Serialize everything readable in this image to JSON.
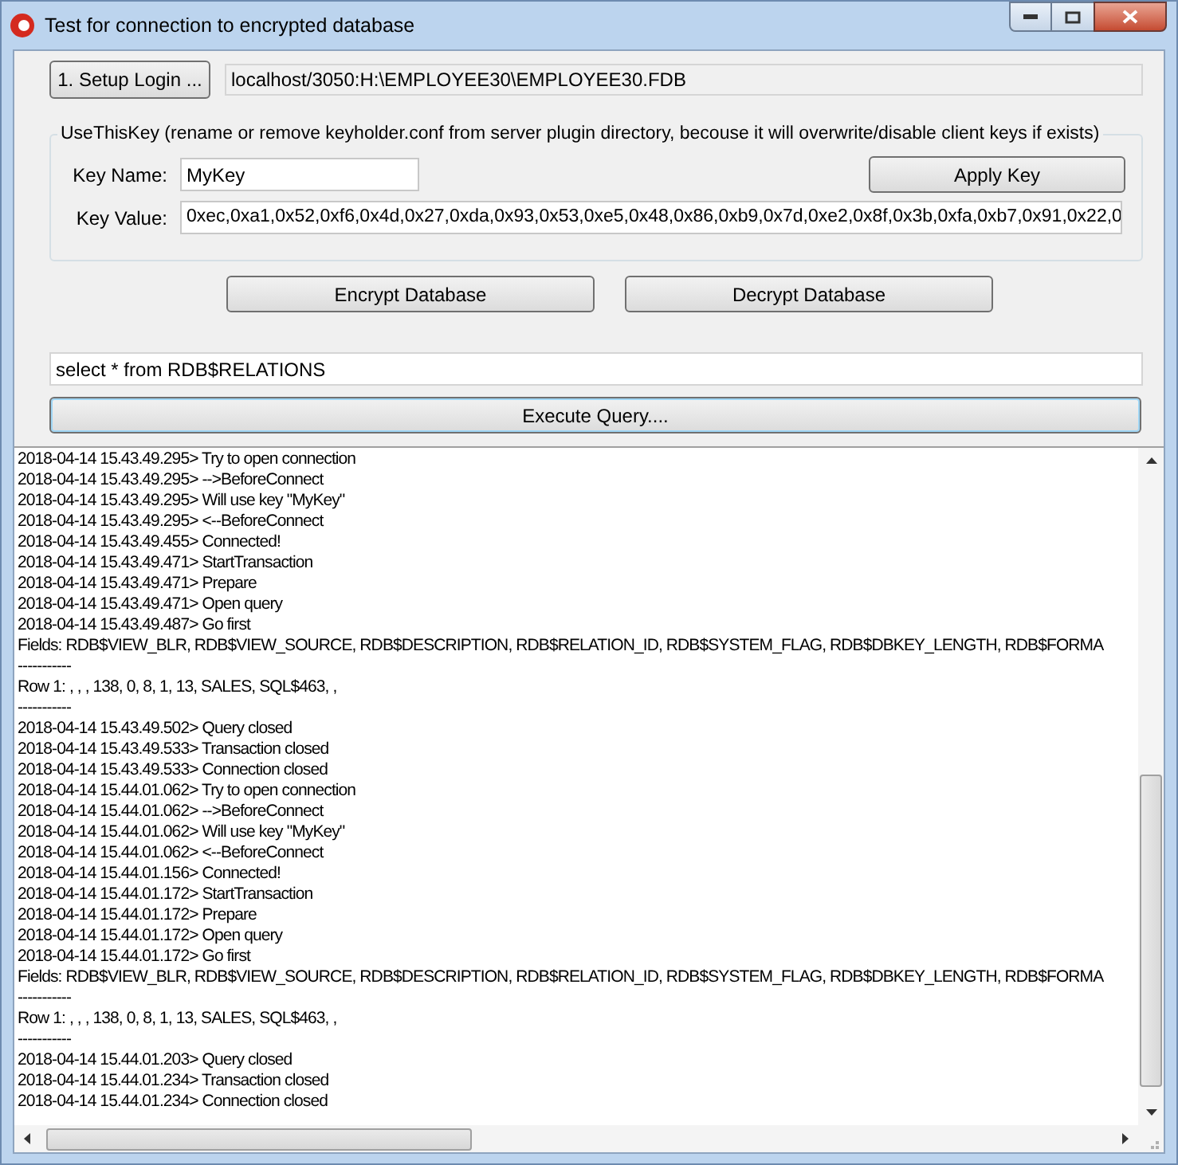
{
  "window": {
    "title": "Test for connection to encrypted database"
  },
  "setup_button": {
    "label": "1. Setup Login ..."
  },
  "database_path": {
    "value": "localhost/3050:H:\\EMPLOYEE30\\EMPLOYEE30.FDB"
  },
  "key_group": {
    "legend": "UseThisKey (rename or remove keyholder.conf from server plugin directory, becouse it will overwrite/disable client keys if exists)",
    "key_name_label": "Key Name:",
    "key_name_value": "MyKey",
    "apply_button": "Apply Key",
    "key_value_label": "Key Value:",
    "key_value_value": "0xec,0xa1,0x52,0xf6,0x4d,0x27,0xda,0x93,0x53,0xe5,0x48,0x86,0xb9,0x7d,0xe2,0x8f,0x3b,0xfa,0xb7,0x91,0x22,0"
  },
  "encrypt_button": "Encrypt Database",
  "decrypt_button": "Decrypt Database",
  "query": {
    "value": "select * from RDB$RELATIONS"
  },
  "execute_button": {
    "label": "Execute Query....",
    "focused": true
  },
  "log": [
    "2018-04-14 15.43.49.295> Try to open connection",
    "2018-04-14 15.43.49.295> -->BeforeConnect",
    "2018-04-14 15.43.49.295> Will use key \"MyKey\"",
    "2018-04-14 15.43.49.295> <--BeforeConnect",
    "2018-04-14 15.43.49.455> Connected!",
    "2018-04-14 15.43.49.471> StartTransaction",
    "2018-04-14 15.43.49.471> Prepare",
    "2018-04-14 15.43.49.471> Open query",
    "2018-04-14 15.43.49.487> Go first",
    "Fields: RDB$VIEW_BLR, RDB$VIEW_SOURCE, RDB$DESCRIPTION, RDB$RELATION_ID, RDB$SYSTEM_FLAG, RDB$DBKEY_LENGTH, RDB$FORMA",
    "-----------",
    "Row 1: , , , 138, 0, 8, 1, 13, SALES, SQL$463, ,",
    "-----------",
    "2018-04-14 15.43.49.502> Query closed",
    "2018-04-14 15.43.49.533> Transaction closed",
    "2018-04-14 15.43.49.533> Connection closed",
    "2018-04-14 15.44.01.062> Try to open connection",
    "2018-04-14 15.44.01.062> -->BeforeConnect",
    "2018-04-14 15.44.01.062> Will use key \"MyKey\"",
    "2018-04-14 15.44.01.062> <--BeforeConnect",
    "2018-04-14 15.44.01.156> Connected!",
    "2018-04-14 15.44.01.172> StartTransaction",
    "2018-04-14 15.44.01.172> Prepare",
    "2018-04-14 15.44.01.172> Open query",
    "2018-04-14 15.44.01.172> Go first",
    "Fields: RDB$VIEW_BLR, RDB$VIEW_SOURCE, RDB$DESCRIPTION, RDB$RELATION_ID, RDB$SYSTEM_FLAG, RDB$DBKEY_LENGTH, RDB$FORMA",
    "-----------",
    "Row 1: , , , 138, 0, 8, 1, 13, SALES, SQL$463, ,",
    "-----------",
    "2018-04-14 15.44.01.203> Query closed",
    "2018-04-14 15.44.01.234> Transaction closed",
    "2018-04-14 15.44.01.234> Connection closed"
  ]
}
